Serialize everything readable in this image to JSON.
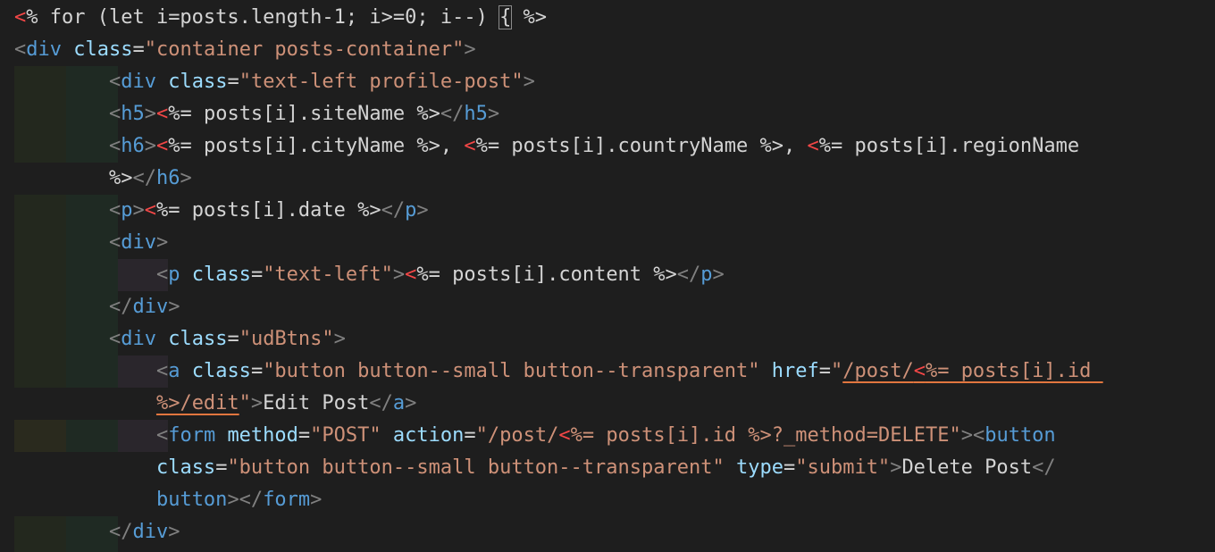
{
  "editor": {
    "language": "ejs",
    "colors": {
      "background": "#1e1e1e",
      "ejs_delimiter": "#f44747",
      "tag": "#569cd6",
      "attribute": "#9cdcfe",
      "string": "#ce9178",
      "text": "#d4d4d4",
      "punctuation": "#808080",
      "squiggle": "#e2763f"
    },
    "lines": [
      {
        "id": "l1",
        "tokens": [
          {
            "c": "t-delim",
            "t": "<"
          },
          {
            "c": "t-ejs",
            "t": "% for (let i=posts.length-1; i>=0; i--) "
          },
          {
            "c": "t-ejs cursor-brace",
            "t": "{"
          },
          {
            "c": "t-ejs",
            "t": " %>"
          }
        ]
      },
      {
        "id": "l2",
        "tokens": [
          {
            "c": "t-punct",
            "t": "<"
          },
          {
            "c": "t-tag",
            "t": "div"
          },
          {
            "c": "t-text",
            "t": " "
          },
          {
            "c": "t-attr",
            "t": "class"
          },
          {
            "c": "t-text",
            "t": "="
          },
          {
            "c": "t-str",
            "t": "\"container posts-container\""
          },
          {
            "c": "t-punct",
            "t": ">"
          }
        ]
      },
      {
        "id": "l3",
        "tokens": [
          {
            "c": "t-text",
            "t": "        "
          },
          {
            "c": "t-punct",
            "t": "<"
          },
          {
            "c": "t-tag",
            "t": "div"
          },
          {
            "c": "t-text",
            "t": " "
          },
          {
            "c": "t-attr",
            "t": "class"
          },
          {
            "c": "t-text",
            "t": "="
          },
          {
            "c": "t-str",
            "t": "\"text-left profile-post\""
          },
          {
            "c": "t-punct",
            "t": ">"
          }
        ]
      },
      {
        "id": "l4",
        "tokens": [
          {
            "c": "t-text",
            "t": "        "
          },
          {
            "c": "t-punct",
            "t": "<"
          },
          {
            "c": "t-tag",
            "t": "h5"
          },
          {
            "c": "t-punct",
            "t": ">"
          },
          {
            "c": "t-delim",
            "t": "<"
          },
          {
            "c": "t-ejs",
            "t": "%= posts[i].siteName %>"
          },
          {
            "c": "t-punct",
            "t": "</"
          },
          {
            "c": "t-tag",
            "t": "h5"
          },
          {
            "c": "t-punct",
            "t": ">"
          }
        ]
      },
      {
        "id": "l5",
        "tokens": [
          {
            "c": "t-text",
            "t": "        "
          },
          {
            "c": "t-punct",
            "t": "<"
          },
          {
            "c": "t-tag",
            "t": "h6"
          },
          {
            "c": "t-punct",
            "t": ">"
          },
          {
            "c": "t-delim",
            "t": "<"
          },
          {
            "c": "t-ejs",
            "t": "%= posts[i].cityName %>, "
          },
          {
            "c": "t-delim",
            "t": "<"
          },
          {
            "c": "t-ejs",
            "t": "%= posts[i].countryName %>, "
          },
          {
            "c": "t-delim",
            "t": "<"
          },
          {
            "c": "t-ejs",
            "t": "%= posts[i].regionName"
          }
        ]
      },
      {
        "id": "l6",
        "tokens": [
          {
            "c": "t-text",
            "t": "        "
          },
          {
            "c": "t-ejs",
            "t": "%>"
          },
          {
            "c": "t-punct",
            "t": "</"
          },
          {
            "c": "t-tag",
            "t": "h6"
          },
          {
            "c": "t-punct",
            "t": ">"
          }
        ]
      },
      {
        "id": "l7",
        "tokens": [
          {
            "c": "t-text",
            "t": "        "
          },
          {
            "c": "t-punct",
            "t": "<"
          },
          {
            "c": "t-tag",
            "t": "p"
          },
          {
            "c": "t-punct",
            "t": ">"
          },
          {
            "c": "t-delim",
            "t": "<"
          },
          {
            "c": "t-ejs",
            "t": "%= posts[i].date %>"
          },
          {
            "c": "t-punct",
            "t": "</"
          },
          {
            "c": "t-tag",
            "t": "p"
          },
          {
            "c": "t-punct",
            "t": ">"
          }
        ]
      },
      {
        "id": "l8",
        "tokens": [
          {
            "c": "t-text",
            "t": "        "
          },
          {
            "c": "t-punct",
            "t": "<"
          },
          {
            "c": "t-tag",
            "t": "div"
          },
          {
            "c": "t-punct",
            "t": ">"
          }
        ]
      },
      {
        "id": "l9",
        "tokens": [
          {
            "c": "t-text",
            "t": "            "
          },
          {
            "c": "t-punct",
            "t": "<"
          },
          {
            "c": "t-tag",
            "t": "p"
          },
          {
            "c": "t-text",
            "t": " "
          },
          {
            "c": "t-attr",
            "t": "class"
          },
          {
            "c": "t-text",
            "t": "="
          },
          {
            "c": "t-str",
            "t": "\"text-left\""
          },
          {
            "c": "t-punct",
            "t": ">"
          },
          {
            "c": "t-delim",
            "t": "<"
          },
          {
            "c": "t-ejs",
            "t": "%= posts[i].content %>"
          },
          {
            "c": "t-punct",
            "t": "</"
          },
          {
            "c": "t-tag",
            "t": "p"
          },
          {
            "c": "t-punct",
            "t": ">"
          }
        ]
      },
      {
        "id": "l10",
        "tokens": [
          {
            "c": "t-text",
            "t": "        "
          },
          {
            "c": "t-punct",
            "t": "</"
          },
          {
            "c": "t-tag",
            "t": "div"
          },
          {
            "c": "t-punct",
            "t": ">"
          }
        ]
      },
      {
        "id": "l11",
        "tokens": [
          {
            "c": "t-text",
            "t": "        "
          },
          {
            "c": "t-punct",
            "t": "<"
          },
          {
            "c": "t-tag",
            "t": "div"
          },
          {
            "c": "t-text",
            "t": " "
          },
          {
            "c": "t-attr",
            "t": "class"
          },
          {
            "c": "t-text",
            "t": "="
          },
          {
            "c": "t-str",
            "t": "\"udBtns\""
          },
          {
            "c": "t-punct",
            "t": ">"
          }
        ]
      },
      {
        "id": "l12",
        "tokens": [
          {
            "c": "t-text",
            "t": "            "
          },
          {
            "c": "t-punct",
            "t": "<"
          },
          {
            "c": "t-tag",
            "t": "a"
          },
          {
            "c": "t-text",
            "t": " "
          },
          {
            "c": "t-attr",
            "t": "class"
          },
          {
            "c": "t-text",
            "t": "="
          },
          {
            "c": "t-str",
            "t": "\"button button--small button--transparent\""
          },
          {
            "c": "t-text",
            "t": " "
          },
          {
            "c": "t-attr",
            "t": "href"
          },
          {
            "c": "t-text",
            "t": "="
          },
          {
            "c": "t-str",
            "t": "\""
          },
          {
            "c": "t-str squiggle",
            "t": "/post/"
          },
          {
            "c": "t-delim squiggle",
            "t": "<"
          },
          {
            "c": "t-str squiggle",
            "t": "%= posts[i].id "
          }
        ]
      },
      {
        "id": "l13",
        "tokens": [
          {
            "c": "t-text",
            "t": "            "
          },
          {
            "c": "t-str squiggle",
            "t": "%>/edit"
          },
          {
            "c": "t-str",
            "t": "\""
          },
          {
            "c": "t-punct",
            "t": ">"
          },
          {
            "c": "t-text",
            "t": "Edit Post"
          },
          {
            "c": "t-punct",
            "t": "</"
          },
          {
            "c": "t-tag",
            "t": "a"
          },
          {
            "c": "t-punct",
            "t": ">"
          }
        ]
      },
      {
        "id": "l14",
        "tokens": [
          {
            "c": "t-text",
            "t": "            "
          },
          {
            "c": "t-punct",
            "t": "<"
          },
          {
            "c": "t-tag",
            "t": "form"
          },
          {
            "c": "t-text",
            "t": " "
          },
          {
            "c": "t-attr",
            "t": "method"
          },
          {
            "c": "t-text",
            "t": "="
          },
          {
            "c": "t-str",
            "t": "\"POST\""
          },
          {
            "c": "t-text",
            "t": " "
          },
          {
            "c": "t-attr",
            "t": "action"
          },
          {
            "c": "t-text",
            "t": "="
          },
          {
            "c": "t-str",
            "t": "\"/post/"
          },
          {
            "c": "t-delim",
            "t": "<"
          },
          {
            "c": "t-str",
            "t": "%= posts[i].id %>?_method=DELETE\""
          },
          {
            "c": "t-punct",
            "t": "><"
          },
          {
            "c": "t-tag",
            "t": "button"
          }
        ]
      },
      {
        "id": "l15",
        "tokens": [
          {
            "c": "t-text",
            "t": "            "
          },
          {
            "c": "t-attr",
            "t": "class"
          },
          {
            "c": "t-text",
            "t": "="
          },
          {
            "c": "t-str",
            "t": "\"button button--small button--transparent\""
          },
          {
            "c": "t-text",
            "t": " "
          },
          {
            "c": "t-attr",
            "t": "type"
          },
          {
            "c": "t-text",
            "t": "="
          },
          {
            "c": "t-str",
            "t": "\"submit\""
          },
          {
            "c": "t-punct",
            "t": ">"
          },
          {
            "c": "t-text",
            "t": "Delete Post"
          },
          {
            "c": "t-punct",
            "t": "</"
          }
        ]
      },
      {
        "id": "l16",
        "tokens": [
          {
            "c": "t-text",
            "t": "            "
          },
          {
            "c": "t-tag",
            "t": "button"
          },
          {
            "c": "t-punct",
            "t": "></"
          },
          {
            "c": "t-tag",
            "t": "form"
          },
          {
            "c": "t-punct",
            "t": ">"
          }
        ]
      },
      {
        "id": "l17",
        "tokens": [
          {
            "c": "t-text",
            "t": "        "
          },
          {
            "c": "t-punct",
            "t": "</"
          },
          {
            "c": "t-tag",
            "t": "div"
          },
          {
            "c": "t-punct",
            "t": ">"
          }
        ]
      }
    ]
  }
}
